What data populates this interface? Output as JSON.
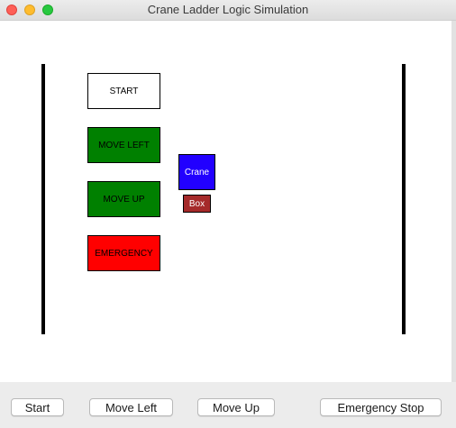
{
  "window": {
    "title": "Crane Ladder Logic Simulation"
  },
  "ladder": {
    "start": {
      "label": "START",
      "color": "#ffffff"
    },
    "move_left": {
      "label": "MOVE LEFT",
      "color": "#008000"
    },
    "move_up": {
      "label": "MOVE UP",
      "color": "#008000"
    },
    "emergency": {
      "label": "EMERGENCY",
      "color": "#ff0000"
    }
  },
  "crane": {
    "label": "Crane",
    "color": "#2200ff"
  },
  "box": {
    "label": "Box",
    "color": "#a52a2a"
  },
  "controls": {
    "start_label": "Start",
    "move_left_label": "Move Left",
    "move_up_label": "Move Up",
    "emergency_stop_label": "Emergency Stop"
  }
}
